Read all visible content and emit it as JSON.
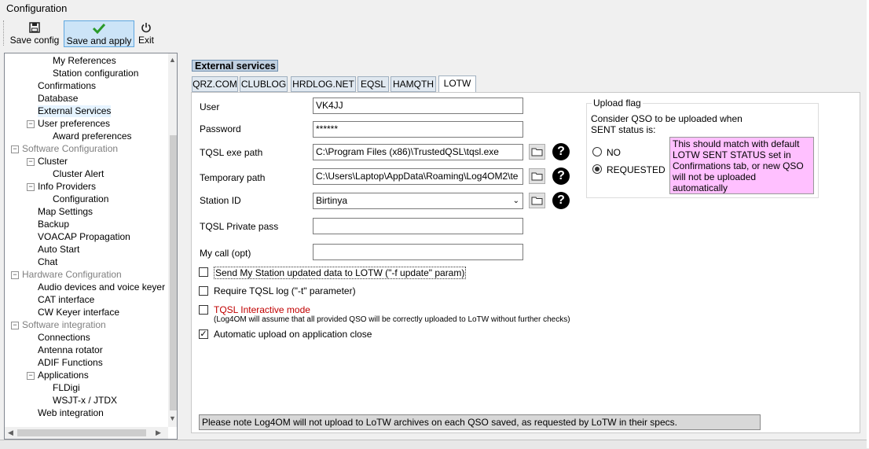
{
  "window": {
    "title": "Configuration"
  },
  "toolbar": {
    "save_config": "Save config",
    "save_apply": "Save and apply",
    "exit": "Exit"
  },
  "tree": [
    {
      "label": "My References",
      "level": 3,
      "gray": false,
      "selected": false
    },
    {
      "label": "Station configuration",
      "level": 3,
      "gray": false,
      "selected": false
    },
    {
      "label": "Confirmations",
      "level": 2,
      "gray": false,
      "selected": false
    },
    {
      "label": "Database",
      "level": 2,
      "gray": false,
      "selected": false
    },
    {
      "label": "External Services",
      "level": 2,
      "gray": false,
      "selected": true
    },
    {
      "label": "User preferences",
      "level": 2,
      "gray": false,
      "selected": false,
      "expander": "−"
    },
    {
      "label": "Award preferences",
      "level": 3,
      "gray": false,
      "selected": false
    },
    {
      "label": "Software Configuration",
      "level": 1,
      "gray": true,
      "selected": false,
      "expander": "−"
    },
    {
      "label": "Cluster",
      "level": 2,
      "gray": false,
      "selected": false,
      "expander": "−"
    },
    {
      "label": "Cluster Alert",
      "level": 3,
      "gray": false,
      "selected": false
    },
    {
      "label": "Info Providers",
      "level": 2,
      "gray": false,
      "selected": false,
      "expander": "−"
    },
    {
      "label": "Configuration",
      "level": 3,
      "gray": false,
      "selected": false
    },
    {
      "label": "Map Settings",
      "level": 2,
      "gray": false,
      "selected": false
    },
    {
      "label": "Backup",
      "level": 2,
      "gray": false,
      "selected": false
    },
    {
      "label": "VOACAP Propagation",
      "level": 2,
      "gray": false,
      "selected": false
    },
    {
      "label": "Auto Start",
      "level": 2,
      "gray": false,
      "selected": false
    },
    {
      "label": "Chat",
      "level": 2,
      "gray": false,
      "selected": false
    },
    {
      "label": "Hardware Configuration",
      "level": 1,
      "gray": true,
      "selected": false,
      "expander": "−"
    },
    {
      "label": "Audio devices and voice keyer",
      "level": 2,
      "gray": false,
      "selected": false
    },
    {
      "label": "CAT interface",
      "level": 2,
      "gray": false,
      "selected": false
    },
    {
      "label": "CW Keyer interface",
      "level": 2,
      "gray": false,
      "selected": false
    },
    {
      "label": "Software integration",
      "level": 1,
      "gray": true,
      "selected": false,
      "expander": "−"
    },
    {
      "label": "Connections",
      "level": 2,
      "gray": false,
      "selected": false
    },
    {
      "label": "Antenna rotator",
      "level": 2,
      "gray": false,
      "selected": false
    },
    {
      "label": "ADIF Functions",
      "level": 2,
      "gray": false,
      "selected": false
    },
    {
      "label": "Applications",
      "level": 2,
      "gray": false,
      "selected": false,
      "expander": "−"
    },
    {
      "label": "FLDigi",
      "level": 3,
      "gray": false,
      "selected": false
    },
    {
      "label": "WSJT-x / JTDX",
      "level": 3,
      "gray": false,
      "selected": false
    },
    {
      "label": "Web integration",
      "level": 2,
      "gray": false,
      "selected": false
    }
  ],
  "section_title": "External services",
  "tabs": [
    "QRZ.COM",
    "CLUBLOG",
    "HRDLOG.NET",
    "EQSL",
    "HAMQTH",
    "LOTW"
  ],
  "active_tab": "LOTW",
  "form": {
    "user": {
      "label": "User",
      "value": "VK4JJ"
    },
    "password": {
      "label": "Password",
      "value": "******"
    },
    "tqsl_exe": {
      "label": "TQSL exe path",
      "value": "C:\\Program Files (x86)\\TrustedQSL\\tqsl.exe"
    },
    "temp_path": {
      "label": "Temporary path",
      "value": "C:\\Users\\Laptop\\AppData\\Roaming\\Log4OM2\\te"
    },
    "station_id": {
      "label": "Station ID",
      "value": "Birtinya"
    },
    "tqsl_private": {
      "label": "TQSL Private pass",
      "value": ""
    },
    "my_call": {
      "label": "My call (opt)",
      "value": ""
    }
  },
  "checkboxes": {
    "send_station": {
      "label": "Send My Station updated data to LOTW (\"-f update\" param)",
      "checked": false
    },
    "require_log": {
      "label": "Require TQSL log (\"-t\" parameter)",
      "checked": false
    },
    "interactive": {
      "label": "TQSL Interactive mode",
      "checked": false
    },
    "interactive_note": "(Log4OM will assume that all provided QSO will be correctly uploaded to LoTW without further checks)",
    "auto_upload": {
      "label": "Automatic upload on application close",
      "checked": true
    }
  },
  "upload_flag": {
    "caption": "Upload flag",
    "desc_line1": "Consider QSO to be uploaded when",
    "desc_line2": "SENT status is:",
    "no_label": "NO",
    "requested_label": "REQUESTED",
    "selected": "REQUESTED",
    "hint_lines": [
      "This should match with default",
      "LOTW SENT STATUS set in",
      "Confirmations tab, or new QSO",
      "will not be uploaded",
      "automatically"
    ]
  },
  "note": "Please note Log4OM will not upload to LoTW archives on each QSO saved, as requested by LoTW in their specs.",
  "colors": {
    "interactive_mode_text": "#c00000",
    "hint_bg": "#ffc0ff",
    "active_button_bg": "#cce4f7"
  },
  "icons": {
    "save": "floppy-icon",
    "apply": "checkmark-icon",
    "exit": "power-icon",
    "folder": "folder-icon",
    "help": "question-icon"
  }
}
